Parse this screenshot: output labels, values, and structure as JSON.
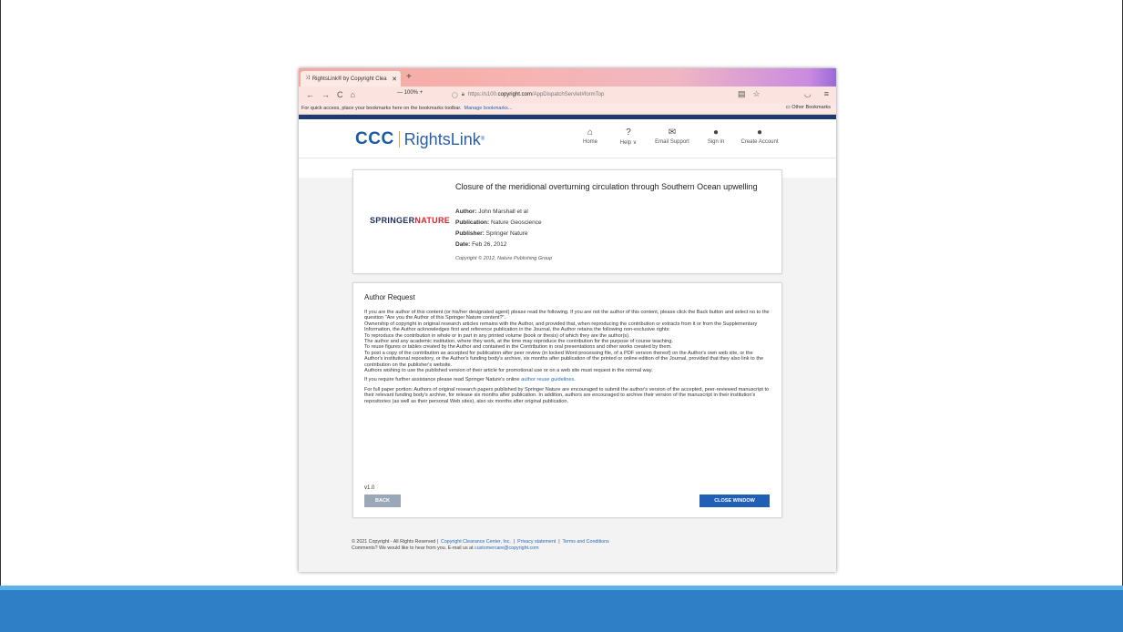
{
  "browser": {
    "tab_title": "RightsLink® by Copyright Clea",
    "zoom": "100%",
    "url_prefix": "https://s100.",
    "url_domain": "copyright.com",
    "url_path": "/AppDispatchServlet#formTop",
    "bookmarks_hint": "For quick access, place your bookmarks here on the bookmarks toolbar.",
    "manage_bookmarks": "Manage bookmarks...",
    "other_bookmarks": "Other Bookmarks"
  },
  "site": {
    "logo_ccc": "CCC",
    "logo_rightslink": "RightsLink",
    "nav": [
      {
        "label": "Home"
      },
      {
        "label": "Help ∨"
      },
      {
        "label": "Email Support"
      },
      {
        "label": "Sign in"
      },
      {
        "label": "Create Account"
      }
    ]
  },
  "article": {
    "publisher_logo_a": "SPRINGER",
    "publisher_logo_b": "NATURE",
    "title": "Closure of the meridional overturning circulation through Southern Ocean upwelling",
    "author_label": "Author:",
    "author": "John Marshall et al",
    "publication_label": "Publication:",
    "publication": "Nature Geoscience",
    "publisher_label": "Publisher:",
    "publisher": "Springer Nature",
    "date_label": "Date:",
    "date": "Feb 26, 2012",
    "copyright": "Copyright © 2012, Nature Publishing Group"
  },
  "request": {
    "title": "Author Request",
    "p1": "If you are the author of this content (or his/her designated agent) please read the following. If you are not the author of this content, please click the Back button and select no to the question \"Are you the Author of this Springer Nature content?\".",
    "p2": "Ownership of copyright in original research articles remains with the Author, and provided that, when reproducing the contribution or extracts from it or from the Supplementary Information, the Author acknowledges first and reference publication in the Journal, the Author retains the following non-exclusive rights:",
    "p3": "To reproduce the contribution in whole or in part in any printed volume (book or thesis) of which they are the author(s).",
    "p4": "The author and any academic institution, where they work, at the time may reproduce the contribution for the purpose of course teaching.",
    "p5": "To reuse figures or tables created by the Author and contained in the Contribution in oral presentations and other works created by them.",
    "p6": "To post a copy of the contribution as accepted for publication after peer review (in locked Word processing file, of a PDF version thereof) on the Author's own web site, or the Author's institutional repository, or the Author's funding body's archive, six months after publication of the printed or online edition of the Journal, provided that they also link to the contribution on the publisher's website.",
    "p7": "Authors wishing to use the published version of their article for promotional use or on a web site must request in the normal way.",
    "assist_text": "If you require further assistance please read Springer Nature's online",
    "assist_link": "author reuse guidelines.",
    "full_paper": "For full paper portion: Authors of original research papers published by Springer Nature are encouraged to submit the author's version of the accepted, peer-reviewed manuscript to their relevant funding body's archive, for release six months after publication. In addition, authors are encouraged to archive their version of the manuscript in their institution's repositories (as well as their personal Web sites), also six months after original publication.",
    "version": "v1.0",
    "back_button": "BACK",
    "close_button": "CLOSE WINDOW"
  },
  "footer": {
    "copyright": "© 2021 Copyright - All Rights Reserved   |",
    "ccc_link": "Copyright Clearance Center, Inc.",
    "sep1": "|",
    "privacy_link": "Privacy statement",
    "sep2": "|",
    "terms_link": "Terms and Conditions",
    "comments_text": "Comments? We would like to hear from you. E-mail us at",
    "email_link": "customercare@copyright.com"
  }
}
